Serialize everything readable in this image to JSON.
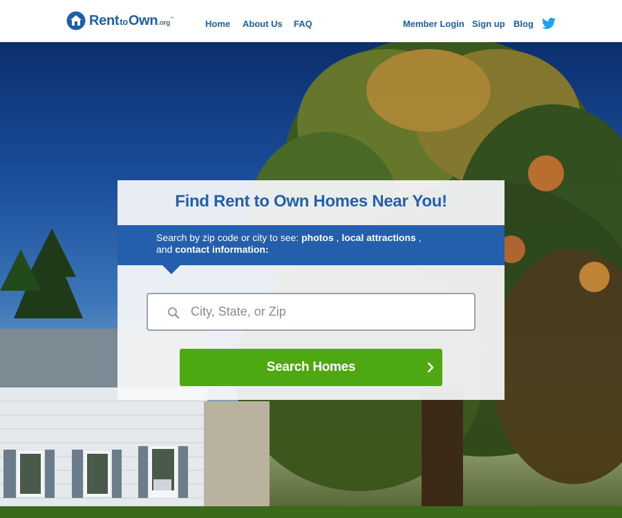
{
  "header": {
    "logo": {
      "rent": "Rent",
      "to": "to",
      "own": "Own",
      "org": ".org",
      "tm": "™"
    },
    "nav_left": [
      {
        "label": "Home"
      },
      {
        "label": "About Us"
      },
      {
        "label": "FAQ"
      }
    ],
    "nav_right": [
      {
        "label": "Member Login"
      },
      {
        "label": "Sign up"
      },
      {
        "label": "Blog"
      }
    ],
    "social_icon": "twitter-icon"
  },
  "search_card": {
    "title": "Find Rent to Own Homes Near You!",
    "band": {
      "prefix": "Search by zip code or city to see: ",
      "photos": "photos",
      "sep1": " , ",
      "attractions": "local attractions",
      "sep2": " ,",
      "and": "and ",
      "contact": "contact information:"
    },
    "search_placeholder": "City, State, or Zip",
    "search_button": "Search Homes"
  },
  "colors": {
    "brand_blue": "#245fae",
    "nav_blue": "#1f5fa8",
    "button_green": "#4da812",
    "twitter_blue": "#1da1f2"
  }
}
